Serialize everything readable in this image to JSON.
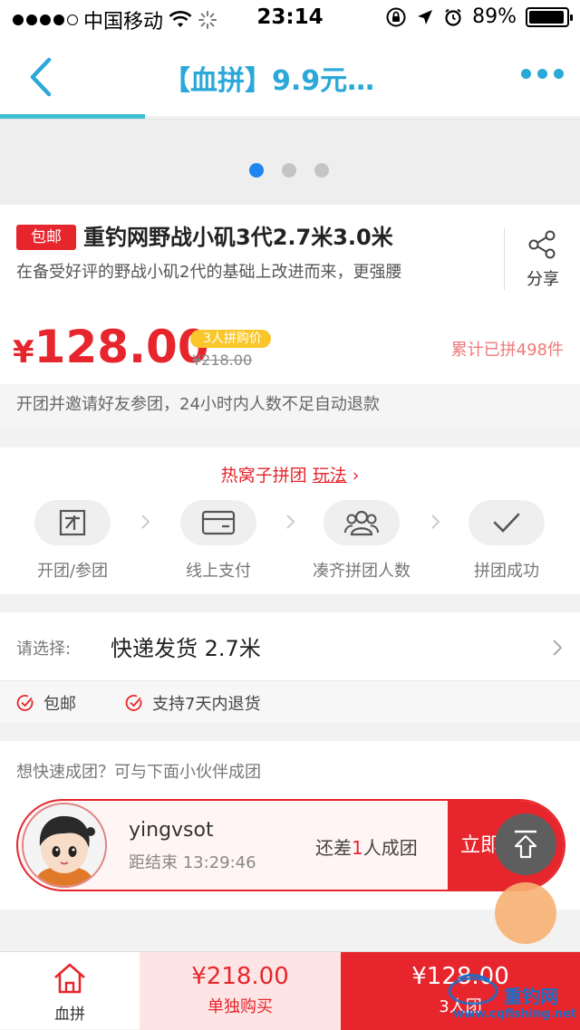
{
  "status_bar": {
    "carrier": "中国移动",
    "time": "23:14",
    "battery": "89%"
  },
  "nav": {
    "title": "【血拼】9.9元…",
    "accent_color": "#2aa8d8"
  },
  "carousel": {
    "pages": 3,
    "active_page": 1
  },
  "product": {
    "free_shipping_tag": "包邮",
    "title": "重钓网野战小矶3代2.7米3.0米",
    "description": "在备受好评的野战小矶2代的基础上改进而来，更强腰",
    "share_label": "分享",
    "price_symbol": "¥",
    "price": "128.00",
    "group_tag": "3人拼购价",
    "original_price": "¥218.00",
    "sold_count": "累计已拼498件",
    "notice": "开团并邀请好友参团，24小时内人数不足自动退款"
  },
  "group_rules": {
    "title": "热窝子拼团",
    "link": "玩法",
    "arrow": "›",
    "steps": [
      {
        "label": "开团/参团",
        "icon": "open-group-icon"
      },
      {
        "label": "线上支付",
        "icon": "card-icon"
      },
      {
        "label": "凑齐拼团人数",
        "icon": "people-icon"
      },
      {
        "label": "拼团成功",
        "icon": "check-icon"
      }
    ]
  },
  "options": {
    "select_label": "请选择:",
    "select_value": "快递发货 2.7米",
    "benefits": [
      "包邮",
      "支持7天内退货"
    ]
  },
  "join": {
    "title": "想快速成团？可与下面小伙伴成团",
    "username": "yingvsot",
    "countdown_prefix": "距结束",
    "countdown": "13:29:46",
    "need_prefix": "还差",
    "need_count": "1",
    "need_suffix": "人成团",
    "button": "立即"
  },
  "bottom_bar": {
    "home_label": "血拼",
    "single_price": "¥218.00",
    "single_label": "单独购买",
    "group_price": "¥128.00",
    "group_label": "3人团"
  },
  "watermark": {
    "brand": "重钓网",
    "url": "www.cqfishing.net"
  },
  "colors": {
    "primary_red": "#e6262c",
    "accent_blue": "#2aa8d8",
    "tag_yellow": "#f9c72b"
  }
}
